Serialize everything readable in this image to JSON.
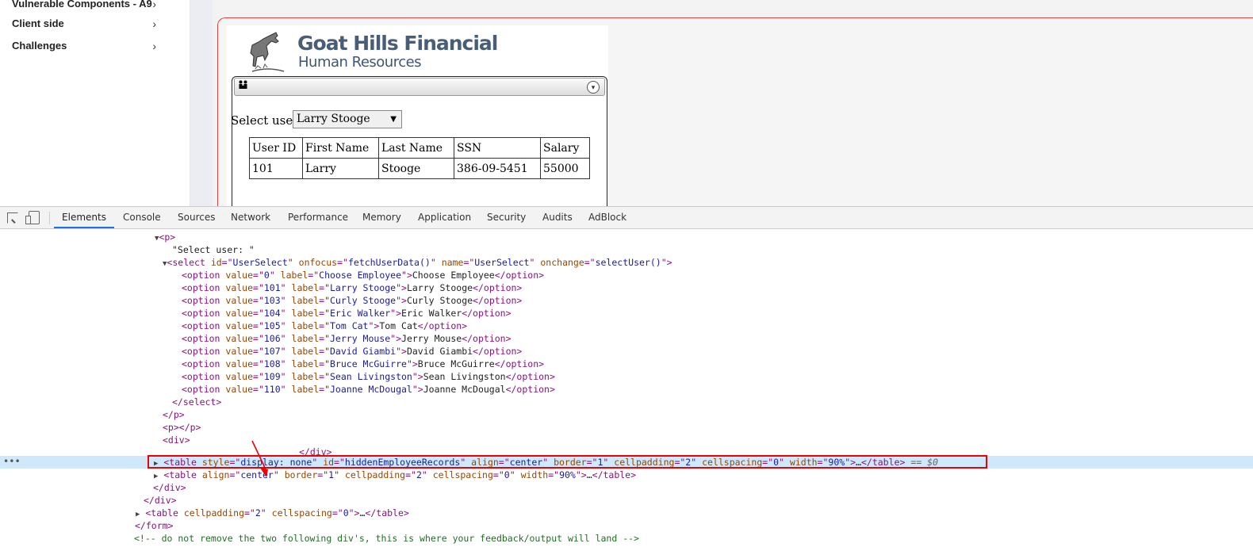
{
  "sidebar": {
    "items": [
      {
        "label": "Vulnerable Components - A9"
      },
      {
        "label": "Client side"
      },
      {
        "label": "Challenges"
      }
    ],
    "chevron": "›"
  },
  "lesson": {
    "brand_title": "Goat Hills Financial",
    "brand_subtitle": "Human Resources",
    "select_label": "Select user:",
    "selected_user": "Larry Stooge",
    "table": {
      "headers": [
        "User ID",
        "First Name",
        "Last Name",
        "SSN",
        "Salary"
      ],
      "rows": [
        [
          "101",
          "Larry",
          "Stooge",
          "386-09-5451",
          "55000"
        ]
      ]
    },
    "icons": {
      "people": "people-icon",
      "collapse": "collapse-circle-icon",
      "logo": "goat-logo-icon"
    }
  },
  "devtools": {
    "tabs": [
      "Elements",
      "Console",
      "Sources",
      "Network",
      "Performance",
      "Memory",
      "Application",
      "Security",
      "Audits",
      "AdBlock"
    ],
    "active_tab": "Elements",
    "dom": {
      "select_user_text": "\"Select user: \"",
      "options": [
        {
          "value": "0",
          "label": "Choose Employee"
        },
        {
          "value": "101",
          "label": "Larry Stooge"
        },
        {
          "value": "103",
          "label": "Curly Stooge"
        },
        {
          "value": "104",
          "label": "Eric Walker"
        },
        {
          "value": "105",
          "label": "Tom Cat"
        },
        {
          "value": "106",
          "label": "Jerry Mouse"
        },
        {
          "value": "107",
          "label": "David Giambi"
        },
        {
          "value": "108",
          "label": "Bruce McGuirre"
        },
        {
          "value": "109",
          "label": "Sean Livingston"
        },
        {
          "value": "110",
          "label": "Joanne McDougal"
        }
      ],
      "selected_marker": "== $0",
      "comment": "<!-- do not remove the two following div's, this is where your feedback/output will land -->"
    }
  }
}
